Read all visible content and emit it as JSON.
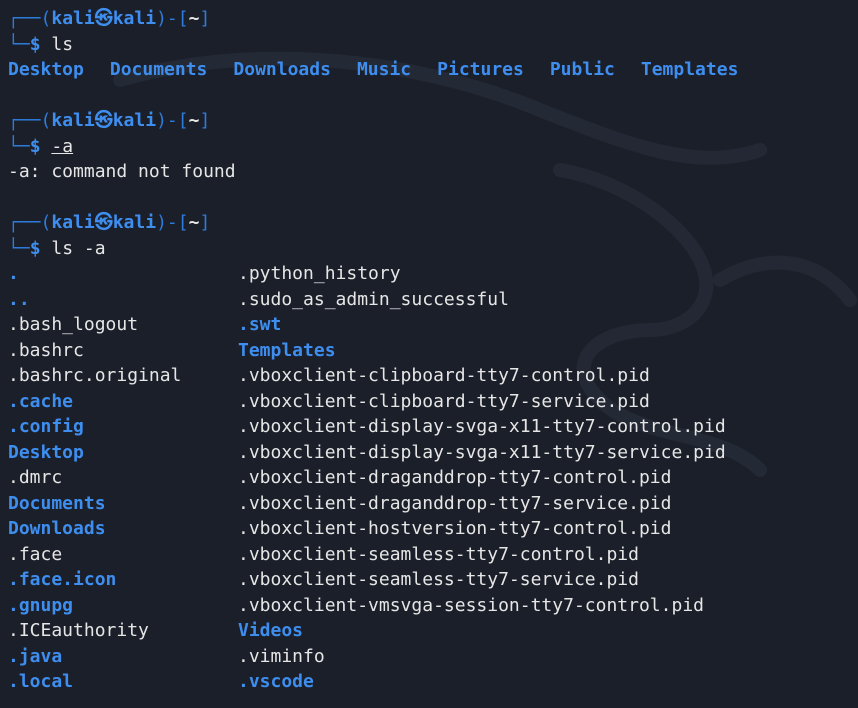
{
  "prompt": {
    "user": "kali",
    "host": "kali",
    "cwd": "~",
    "symbol": "㉿",
    "dollar": "$"
  },
  "commands": [
    "ls",
    "-a",
    "ls -a"
  ],
  "ls_output": [
    "Desktop",
    "Documents",
    "Downloads",
    "Music",
    "Pictures",
    "Public",
    "Templates"
  ],
  "error_message": "-a: command not found",
  "ls_a_rows": [
    [
      "",
      ".python_history"
    ],
    [
      "..",
      ".sudo_as_admin_successful"
    ],
    [
      ".bash_logout",
      ".swt"
    ],
    [
      ".bashrc",
      "Templates"
    ],
    [
      ".bashrc.original",
      ".vboxclient-clipboard-tty7-control.pid"
    ],
    [
      ".cache",
      ".vboxclient-clipboard-tty7-service.pid"
    ],
    [
      ".config",
      ".vboxclient-display-svga-x11-tty7-control.pid"
    ],
    [
      "Desktop",
      ".vboxclient-display-svga-x11-tty7-service.pid"
    ],
    [
      ".dmrc",
      ".vboxclient-draganddrop-tty7-control.pid"
    ],
    [
      "Documents",
      ".vboxclient-draganddrop-tty7-service.pid"
    ],
    [
      "Downloads",
      ".vboxclient-hostversion-tty7-control.pid"
    ],
    [
      ".face",
      ".vboxclient-seamless-tty7-control.pid"
    ],
    [
      ".face.icon",
      ".vboxclient-seamless-tty7-service.pid"
    ],
    [
      ".gnupg",
      ".vboxclient-vmsvga-session-tty7-control.pid"
    ],
    [
      ".ICEauthority",
      "Videos"
    ],
    [
      ".java",
      ".viminfo"
    ],
    [
      ".local",
      ".vscode"
    ]
  ],
  "ls_a_first_row_col1": ".",
  "colors": {
    "background": "#1b1f29",
    "accent_blue": "#3e8ef0",
    "text": "#e6e6e6"
  }
}
